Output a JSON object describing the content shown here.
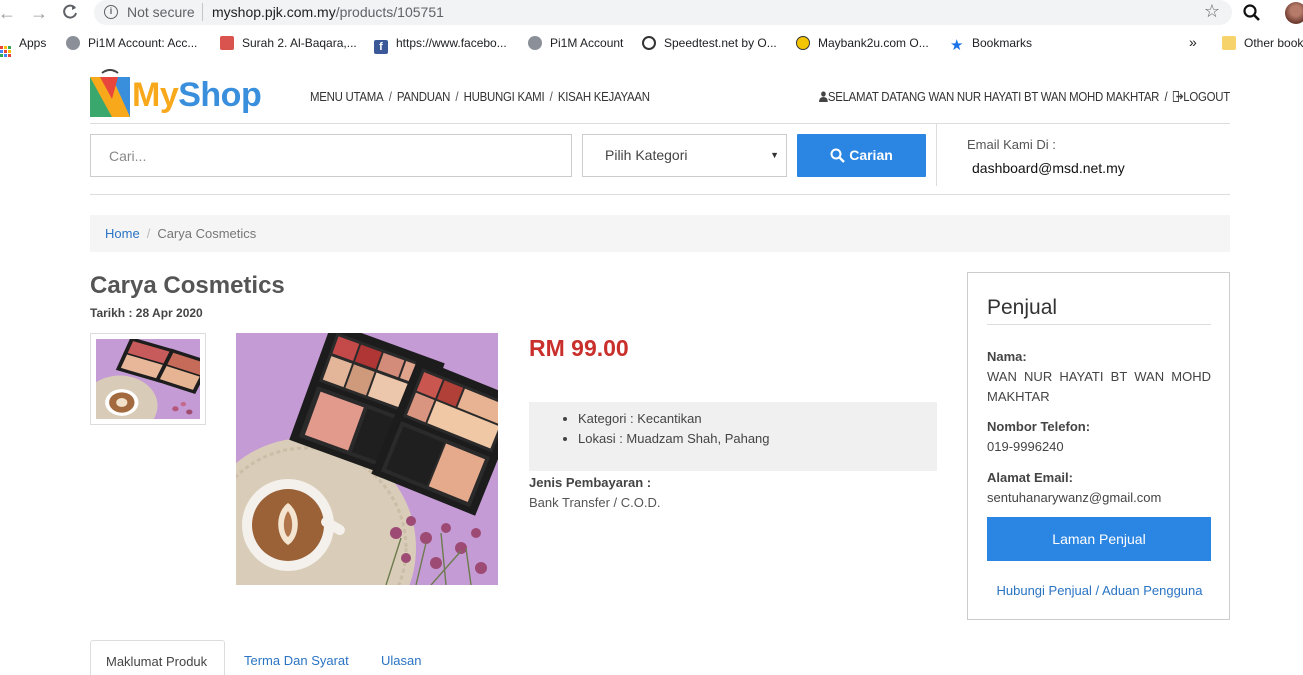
{
  "browser": {
    "security": "Not secure",
    "url_host": "myshop.pjk.com.my",
    "url_path": "/products/105751",
    "bookmarks": [
      {
        "label": "Apps",
        "icon": "apps-grid-icon"
      },
      {
        "label": "Pi1M Account: Acc...",
        "icon": "globe-icon"
      },
      {
        "label": "Surah 2. Al-Baqara,...",
        "icon": "quran-icon"
      },
      {
        "label": "https://www.facebo...",
        "icon": "facebook-icon"
      },
      {
        "label": "Pi1M Account",
        "icon": "globe-icon"
      },
      {
        "label": "Speedtest.net by O...",
        "icon": "speedtest-icon"
      },
      {
        "label": "Maybank2u.com O...",
        "icon": "maybank-icon"
      },
      {
        "label": "Bookmarks",
        "icon": "star-icon"
      }
    ],
    "more_bookmarks": "»",
    "other_bookmarks": "Other book"
  },
  "header": {
    "logo_my": "My",
    "logo_shop": "Shop",
    "nav": [
      "MENU UTAMA",
      "PANDUAN",
      "HUBUNGI KAMI",
      "KISAH KEJAYAAN"
    ],
    "nav_sep": "/",
    "welcome": "SELAMAT DATANG WAN NUR HAYATI BT WAN MOHD MAKHTAR",
    "logout": "LOGOUT"
  },
  "search": {
    "placeholder": "Cari...",
    "category": "Pilih Kategori",
    "button": "Carian"
  },
  "contact": {
    "label": "Email Kami Di :",
    "email": "dashboard@msd.net.my"
  },
  "breadcrumb": {
    "home": "Home",
    "sep": "/",
    "current": "Carya Cosmetics"
  },
  "product": {
    "title": "Carya Cosmetics",
    "date": "Tarikh : 28 Apr 2020",
    "price": "RM 99.00",
    "details": [
      "Kategori : Kecantikan",
      "Lokasi : Muadzam Shah, Pahang"
    ],
    "payment_label": "Jenis Pembayaran :",
    "payment_value": "Bank Transfer / C.O.D."
  },
  "seller": {
    "title": "Penjual",
    "name_label": "Nama:",
    "name": "WAN NUR HAYATI BT WAN MOHD MAKHTAR",
    "phone_label": "Nombor Telefon:",
    "phone": "019-9996240",
    "email_label": "Alamat Email:",
    "email": "sentuhanarywanz@gmail.com",
    "shop_button": "Laman Penjual",
    "contact_link": "Hubungi Penjual / Aduan Pengguna"
  },
  "tabs": [
    "Maklumat Produk",
    "Terma Dan Syarat",
    "Ulasan"
  ],
  "colors": {
    "primary": "#2b85e2",
    "price": "#c9302c",
    "link": "#2a74c4"
  }
}
